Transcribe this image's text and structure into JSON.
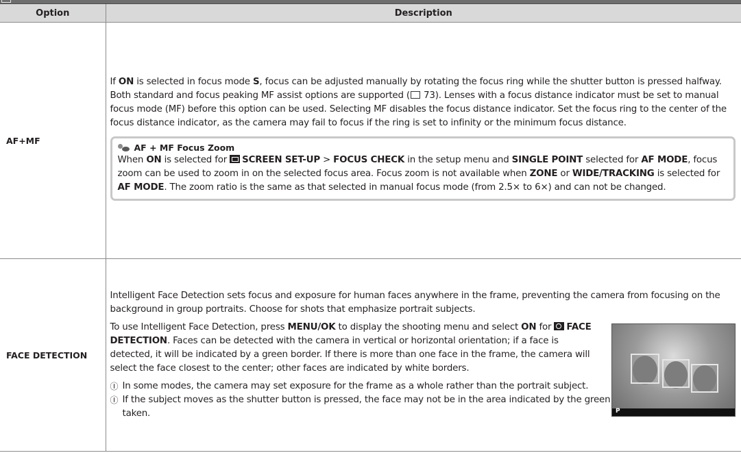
{
  "header": {
    "col_option": "Option",
    "col_description": "Description"
  },
  "afmf": {
    "option": "AF+MF",
    "p1_a": "If ",
    "p1_on": "ON",
    "p1_b": " is selected in focus mode ",
    "p1_s": "S",
    "p1_c": ", focus can be adjusted manually by rotating the focus ring while the shutter button is pressed halfway. Both standard and focus peaking MF assist options are supported (",
    "p1_page": "73",
    "p1_d": "). Lenses with a focus distance indicator must be set to manual focus mode (MF) before this option can be used. Selecting MF disables the focus distance indicator. Set the focus ring to the center of the focus distance indicator, as the camera may fail to focus if the ring is set to infinity or the minimum focus distance.",
    "note_title": "AF + MF Focus Zoom",
    "n_a": "When ",
    "n_on": "ON",
    "n_b": " is selected for ",
    "n_screen": "SCREEN SET-UP",
    "n_c": " > ",
    "n_check": "FOCUS CHECK",
    "n_d": " in the setup menu and ",
    "n_single": "SINGLE POINT",
    "n_e": " selected for ",
    "n_afmode1": "AF MODE",
    "n_f": ", focus zoom can be used to zoom in on the selected focus area. Focus zoom is not available when ",
    "n_zone": "ZONE",
    "n_g": " or ",
    "n_wide": "WIDE/TRACKING",
    "n_h": " is selected for ",
    "n_afmode2": "AF MODE",
    "n_i": ". The zoom ratio is the same as that selected in manual focus mode (from 2.5× to 6×) and can not be changed."
  },
  "face": {
    "option": "FACE DETECTION",
    "p1": "Intelligent Face Detection sets focus and exposure for human faces anywhere in the frame, preventing the camera from focusing on the background in group portraits. Choose for shots that emphasize portrait subjects.",
    "p2_a": "To use Intelligent Face Detection, press ",
    "p2_menu": "MENU/OK",
    "p2_b": " to display the shooting menu and select ",
    "p2_on": "ON",
    "p2_c": " for ",
    "p2_fd": "FACE DETECTION",
    "p2_d": ". Faces can be detected with the camera in vertical or horizontal orientation; if a face is detected, it will be indicated by a green border. If there is more than one face in the frame, the camera will select the face closest to the center; other faces are indicated by white borders.",
    "caution_mark": "Ⓘ",
    "c1": "In some modes, the camera may set exposure for the frame as a whole rather than the portrait subject.",
    "c2": "If the subject moves as the shutter button is pressed, the face may not be in the area indicated by the green border when the picture is taken.",
    "thumb_mode": "P"
  }
}
